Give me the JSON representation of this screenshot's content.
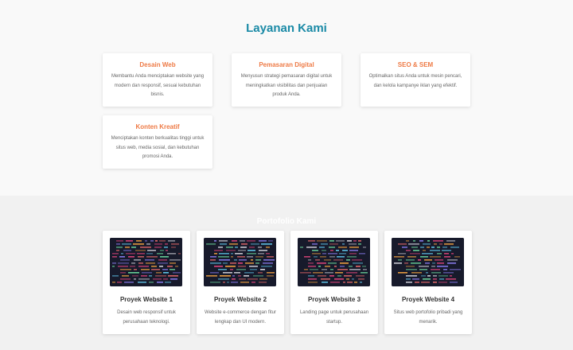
{
  "services": {
    "title": "Layanan Kami",
    "items": [
      {
        "title": "Desain Web",
        "desc": "Membantu Anda menciptakan website yang modern dan responsif, sesuai kebutuhan bisnis."
      },
      {
        "title": "Pemasaran Digital",
        "desc": "Menyusun strategi pemasaran digital untuk meningkatkan visibilitas dan penjualan produk Anda."
      },
      {
        "title": "SEO & SEM",
        "desc": "Optimalkan situs Anda untuk mesin pencari, dan kelola kampanye iklan yang efektif."
      },
      {
        "title": "Konten Kreatif",
        "desc": "Menciptakan konten berkualitas tinggi untuk situs web, media sosial, dan kebutuhan promosi Anda."
      }
    ]
  },
  "portfolio": {
    "title": "Portofolio Kami",
    "items": [
      {
        "title": "Proyek Website 1",
        "desc": "Desain web responsif untuk perusahaan teknologi.",
        "image": "code-screen-image"
      },
      {
        "title": "Proyek Website 2",
        "desc": "Website e-commerce dengan fitur lengkap dan UI modern.",
        "image": "code-screen-image"
      },
      {
        "title": "Proyek Website 3",
        "desc": "Landing page untuk perusahaan startup.",
        "image": "code-screen-image"
      },
      {
        "title": "Proyek Website 4",
        "desc": "Situs web portofolio pribadi yang menarik.",
        "image": "code-screen-image"
      }
    ]
  },
  "colors": {
    "accent": "#1a8aa6",
    "card_title": "#ee7a45",
    "text": "#666666"
  }
}
